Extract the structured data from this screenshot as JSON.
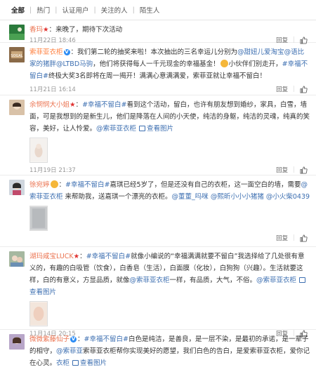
{
  "tabs": [
    "全部",
    "热门",
    "认证用户",
    "关注的人",
    "陌生人"
  ],
  "comments": [
    {
      "user": "香玛",
      "star": "★",
      "text": "来晚了，期待下次活动",
      "time": "11月22日 18:46",
      "reply": "回复"
    },
    {
      "user": "索菲亚衣柜",
      "verified": "V",
      "text1": "我们第二轮的抽奖来啦！本次抽出的三名幸运儿分别为",
      "mention1": "@甜妞儿爱淘宝",
      "mention2": "@语比家的猪胖",
      "mention3": "@LTBD马驹",
      "text2": "，他们将获得每人一千元现金的幸福基金！",
      "text3": "小伙伴们别走开，",
      "tag": "#幸福不留白#",
      "text4": "终极大奖3名即将在周一揭开！满满心意满满爱，索菲亚就让幸福不留白！",
      "time": "11月21日 16:14",
      "reply": "回复"
    },
    {
      "user": "余悯悯大小姐",
      "star": "★",
      "tag": "#幸福不留白#",
      "text": "看到这个活动，留白，也许有朋友想到婚纱，家具，白雪，墙面，可是我想到的是新生儿，他们是降落在人间的小天使，纯洁的身躯，纯洁的灵魂，纯真的笑容，美好，让人怜爱。",
      "mention": "@索菲亚衣柜",
      "pic": "查看图片",
      "time": "11月19日 21:37",
      "reply": "回复"
    },
    {
      "user": "徐宛婷",
      "tag": "#幸福不留白#",
      "text": "嘉琪已经5岁了，但是还没有自己的衣柜，这一面空白的墙，需要",
      "mention": "@索菲亚衣柜",
      "text2": " 来帮助我，送嘉琪一个漂亮的衣柜。",
      "mention2": "@董董_吗咪",
      "mention3": "@熙昕小小小猪猪",
      "mention4": "@小火柴0439",
      "time": "",
      "reply": "回复"
    },
    {
      "user": "湖玛咸宝LUCK",
      "star": "★",
      "tag": "#幸福不留白#",
      "text1": "就像小编说的“幸福满满就要不留白”我选择给了几处很有意义的，有趣的白吸管（饮食），白香皂（生活），白面膜（化妆），白狗狗（兴趣）。生活就要这样，白的有意义，方显品质，就像",
      "mention": "@索菲亚衣柜",
      "text2": "一样，有品质，大气，不俗。",
      "mention2": "@索菲亚衣柜",
      "pic": "查看图片",
      "time": "11月14日 20:15",
      "reply": "回复"
    },
    {
      "user": "微微紫藤仙子",
      "verified": "V",
      "tag": "#幸福不留白#",
      "text": "白色是纯洁，是善良，是一层不染，是最初的承诺，是一辈子的相守，",
      "text2": "索菲亚衣柜帮你实现美好的愿望，我们白色的告白，是爱索菲亚衣柜，爱你记在心灵。",
      "mention": "@索菲亚",
      "mention2": "衣柜",
      "pic": "查看图片"
    }
  ]
}
